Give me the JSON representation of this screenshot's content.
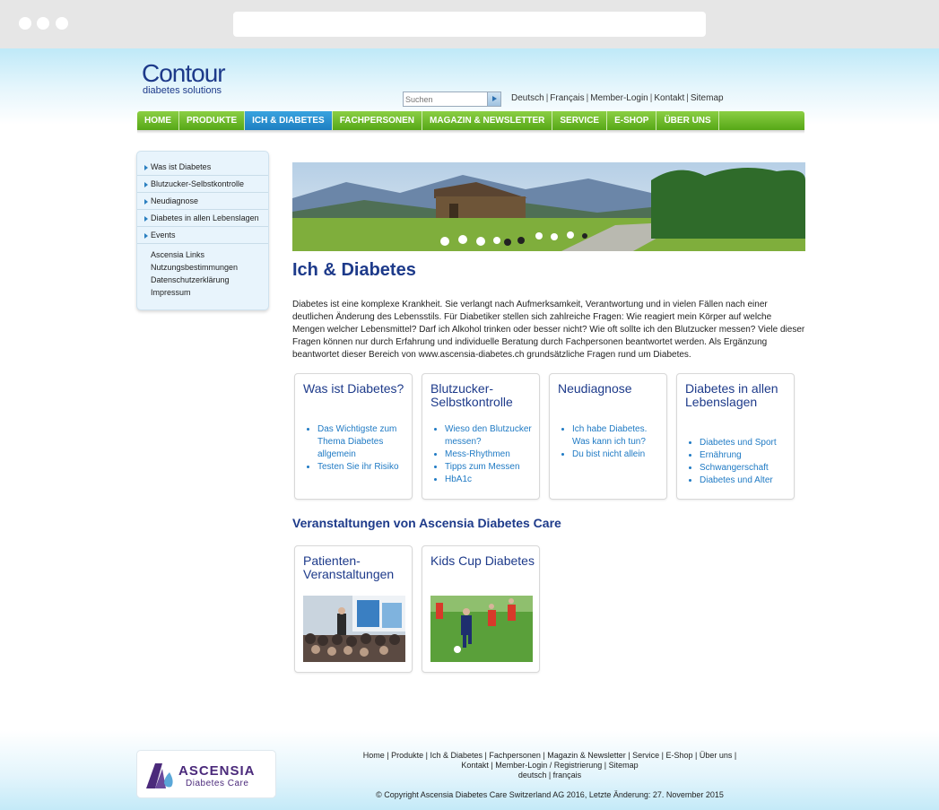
{
  "search": {
    "placeholder": "Suchen"
  },
  "brand": {
    "name": "Contour",
    "tagline": "diabetes solutions"
  },
  "top_links": [
    "Deutsch",
    "Français",
    "Member-Login",
    "Kontakt",
    "Sitemap"
  ],
  "nav": [
    {
      "label": "HOME",
      "active": false
    },
    {
      "label": "PRODUKTE",
      "active": false
    },
    {
      "label": "ICH & DIABETES",
      "active": true
    },
    {
      "label": "FACHPERSONEN",
      "active": false
    },
    {
      "label": "MAGAZIN & NEWSLETTER",
      "active": false
    },
    {
      "label": "SERVICE",
      "active": false
    },
    {
      "label": "E-SHOP",
      "active": false
    },
    {
      "label": "ÜBER UNS",
      "active": false
    }
  ],
  "sidebar": {
    "items": [
      "Was ist Diabetes",
      "Blutzucker-Selbstkontrolle",
      "Neudiagnose",
      "Diabetes in allen Lebenslagen",
      "Events"
    ],
    "sub": [
      "Ascensia Links",
      "Nutzungsbestimmungen",
      "Datenschutzerklärung",
      "Impressum"
    ]
  },
  "main": {
    "title": "Ich & Diabetes",
    "intro": "Diabetes ist eine komplexe Krankheit. Sie verlangt nach Aufmerksamkeit, Verantwortung und in vielen Fällen nach einer deutlichen Änderung des Lebensstils. Für Diabetiker stellen sich zahlreiche Fragen: Wie reagiert mein Körper auf welche Mengen welcher Lebensmittel? Darf ich Alkohol trinken oder besser nicht? Wie oft sollte ich den Blutzucker messen? Viele dieser Fragen können nur durch Erfahrung und individuelle Beratung durch Fachpersonen beantwortet werden. Als Ergänzung beantwortet dieser Bereich von www.ascensia-diabetes.ch grundsätzliche Fragen rund um Diabetes.",
    "cards": [
      {
        "title": "Was ist Diabetes?",
        "links": [
          "Das Wichtigste zum Thema Diabetes allgemein",
          "Testen Sie ihr Risiko"
        ]
      },
      {
        "title": "Blutzucker-Selbstkontrolle",
        "links": [
          "Wieso den Blutzucker messen?",
          "Mess-Rhythmen",
          "Tipps zum Messen",
          "HbA1c"
        ]
      },
      {
        "title": "Neudiagnose",
        "links": [
          "Ich habe Diabetes. Was kann ich tun?",
          "Du bist nicht allein"
        ]
      },
      {
        "title": "Diabetes in allen Lebenslagen",
        "links": [
          "Diabetes und Sport",
          "Ernährung",
          "Schwangerschaft",
          "Diabetes und Alter"
        ]
      }
    ],
    "events_title": "Veranstaltungen von Ascensia Diabetes Care",
    "event_cards": [
      {
        "title": "Patienten-Veranstaltungen"
      },
      {
        "title": "Kids Cup Diabetes"
      }
    ]
  },
  "footer": {
    "logo_name": "ASCENSIA",
    "logo_sub": "Diabetes Care",
    "line1": "Home | Produkte | Ich & Diabetes | Fachpersonen | Magazin & Newsletter | Service | E-Shop | Über uns |",
    "line2": "Kontakt | Member-Login / Registrierung | Sitemap",
    "line3": "deutsch | français",
    "copyright": "© Copyright Ascensia Diabetes Care Switzerland AG 2016, Letzte Änderung: 27. November 2015"
  },
  "colors": {
    "brand_blue": "#1d3a8a",
    "nav_green": "#6bbb2a",
    "nav_active": "#2a91d4",
    "link_blue": "#1f7ac4"
  }
}
